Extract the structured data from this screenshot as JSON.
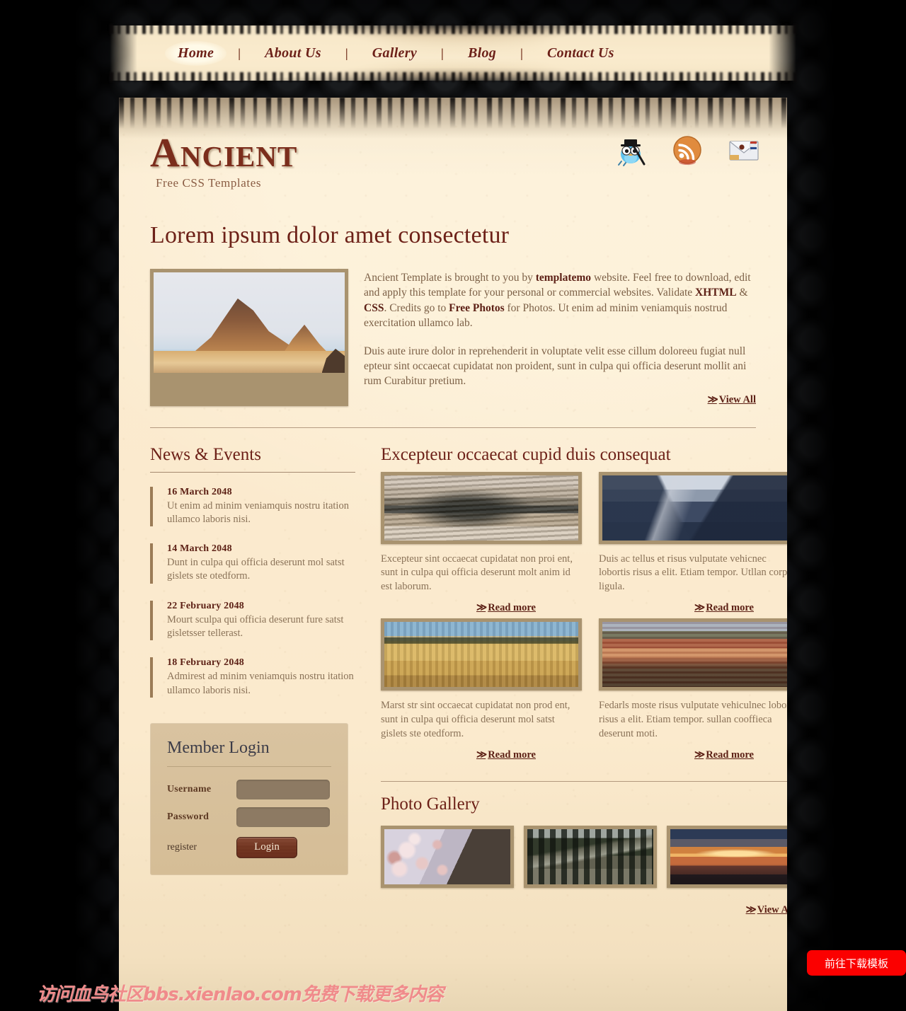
{
  "nav": {
    "separator": "|",
    "items": [
      {
        "label": "Home",
        "active": true
      },
      {
        "label": "About Us",
        "active": false
      },
      {
        "label": "Gallery",
        "active": false
      },
      {
        "label": "Blog",
        "active": false
      },
      {
        "label": "Contact Us",
        "active": false
      }
    ]
  },
  "header": {
    "logo_title": "Ancient",
    "logo_subtitle": "Free CSS Templates",
    "social": [
      {
        "name": "twitter-bird-icon",
        "title": "Twitter"
      },
      {
        "name": "rss-feed-icon",
        "title": "RSS Feed"
      },
      {
        "name": "email-envelope-icon",
        "title": "Email"
      }
    ]
  },
  "hero": {
    "title": "Lorem ipsum dolor amet consectetur",
    "image_alt": "Badlands rock formation",
    "paragraph1_a": "Ancient Template is brought to you by ",
    "link_templatemo": "templatemo",
    "paragraph1_b": " website. Feel free to download, edit and apply this template for your personal or commercial websites. Validate ",
    "link_xhtml": "XHTML",
    "paragraph1_c": " & ",
    "link_css": "CSS",
    "paragraph1_d": ". Credits go to ",
    "link_freephotos": "Free Photos",
    "paragraph1_e": " for Photos. Ut enim ad minim veniamquis nostrud exercitation ullamco lab.",
    "paragraph2": "Duis aute irure dolor in reprehenderit in voluptate velit esse cillum doloreeu fugiat null epteur sint occaecat cupidatat non proident, sunt in culpa qui officia deserunt mollit ani rum Curabitur pretium.",
    "view_all": "View All",
    "chevron": "≫"
  },
  "news": {
    "title": "News & Events",
    "items": [
      {
        "date": "16 March 2048",
        "text": "Ut enim ad minim veniamquis nostru itation ullamco laboris nisi."
      },
      {
        "date": "14 March 2048",
        "text": "Dunt in culpa qui officia deserunt mol satst gislets ste otedform."
      },
      {
        "date": "22 February 2048",
        "text": "Mourt sculpa qui officia deserunt fure satst gisletsser tellerast."
      },
      {
        "date": "18 February 2048",
        "text": "Admirest ad minim veniamquis nostru itation ullamco laboris nisi."
      }
    ]
  },
  "login": {
    "title": "Member Login",
    "username_label": "Username",
    "username_value": "",
    "username_placeholder": "",
    "password_label": "Password",
    "password_value": "",
    "password_placeholder": "",
    "register_label": "register",
    "button_label": "Login"
  },
  "features": {
    "title": "Excepteur occaecat cupid duis consequat",
    "read_more": "Read more",
    "chevron": "≫",
    "cards": [
      {
        "image_alt": "Eroded rock terrain",
        "text": "Excepteur sint occaecat cupidatat non proi ent, sunt in culpa qui officia deserunt molt anim id est laborum."
      },
      {
        "image_alt": "Snowy mountain valley",
        "text": "Duis ac tellus et risus vulputate vehicnec lobortis risus a elit. Etiam tempor. Utllan corper ligula."
      },
      {
        "image_alt": "Golden prairie field",
        "text": "Marst str sint occaecat cupidatat non prod ent, sunt in culpa qui officia deserunt mol satst gislets ste otedform."
      },
      {
        "image_alt": "Red rock mesa",
        "text": "Fedarls moste risus vulputate vehiculnec lobortis risus a elit. Etiam tempor. sullan cooffieca deserunt moti."
      }
    ]
  },
  "gallery": {
    "title": "Photo Gallery",
    "view_all": "View All",
    "chevron": "≫",
    "photos": [
      {
        "image_alt": "Pink blossoms on tree trunk"
      },
      {
        "image_alt": "Wooden bench in park"
      },
      {
        "image_alt": "Sunset over water"
      }
    ]
  },
  "overlay": {
    "watermark": "访问血鸟社区bsbs.xienlao.com免费下载更多内容",
    "watermark_text": "访问血鸟社区bbs.xienlao.com免费下载更多内容",
    "cta_label": "前往下载模板"
  },
  "colors": {
    "paper": "#fbeacd",
    "ink_heading": "#6d2118",
    "ink_body": "#8a7258",
    "frame": "#a9936f",
    "login_box": "#d9c3a0",
    "cta_red": "#fb0000",
    "watermark_pink": "#f08b8b"
  }
}
